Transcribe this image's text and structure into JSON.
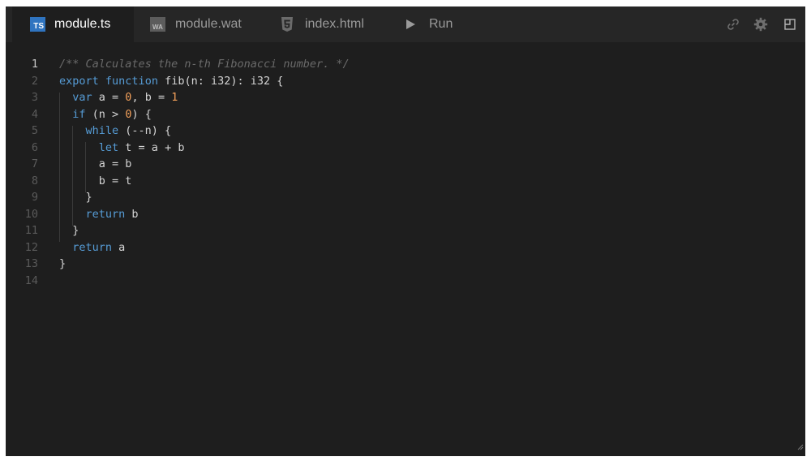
{
  "tabs": [
    {
      "label": "module.ts",
      "icon": "typescript-icon",
      "badge": "TS",
      "active": true
    },
    {
      "label": "module.wat",
      "icon": "wasm-icon",
      "badge": "WA",
      "active": false
    },
    {
      "label": "index.html",
      "icon": "html5-icon",
      "active": false
    },
    {
      "label": "Run",
      "icon": "play-icon",
      "active": false
    }
  ],
  "toolbar_icons": [
    "link-icon",
    "gear-icon",
    "split-view-icon"
  ],
  "colors": {
    "keyword": "#569cd6",
    "number": "#f3a05a",
    "comment": "#6a6a6a",
    "text": "#d4d4d4",
    "background": "#1e1e1e",
    "tab_bar": "#262626",
    "ts_badge": "#2f74c0"
  },
  "editor": {
    "current_line": 1,
    "lines": [
      {
        "n": "1",
        "tokens": [
          {
            "t": "cmt",
            "v": "/** Calculates the n-th Fibonacci number. */"
          }
        ]
      },
      {
        "n": "2",
        "tokens": [
          {
            "t": "kw",
            "v": "export"
          },
          {
            "t": "p",
            "v": " "
          },
          {
            "t": "kw",
            "v": "function"
          },
          {
            "t": "p",
            "v": " fib(n: i32): i32 {"
          }
        ]
      },
      {
        "n": "3",
        "tokens": [
          {
            "t": "p",
            "v": "  "
          },
          {
            "t": "kw",
            "v": "var"
          },
          {
            "t": "p",
            "v": " a = "
          },
          {
            "t": "num",
            "v": "0"
          },
          {
            "t": "p",
            "v": ", b = "
          },
          {
            "t": "num",
            "v": "1"
          }
        ]
      },
      {
        "n": "4",
        "tokens": [
          {
            "t": "p",
            "v": "  "
          },
          {
            "t": "kw",
            "v": "if"
          },
          {
            "t": "p",
            "v": " (n > "
          },
          {
            "t": "num",
            "v": "0"
          },
          {
            "t": "p",
            "v": ") {"
          }
        ]
      },
      {
        "n": "5",
        "tokens": [
          {
            "t": "p",
            "v": "    "
          },
          {
            "t": "kw",
            "v": "while"
          },
          {
            "t": "p",
            "v": " (--n) {"
          }
        ]
      },
      {
        "n": "6",
        "tokens": [
          {
            "t": "p",
            "v": "      "
          },
          {
            "t": "kw",
            "v": "let"
          },
          {
            "t": "p",
            "v": " t = a + b"
          }
        ]
      },
      {
        "n": "7",
        "tokens": [
          {
            "t": "p",
            "v": "      a = b"
          }
        ]
      },
      {
        "n": "8",
        "tokens": [
          {
            "t": "p",
            "v": "      b = t"
          }
        ]
      },
      {
        "n": "9",
        "tokens": [
          {
            "t": "p",
            "v": "    }"
          }
        ]
      },
      {
        "n": "10",
        "tokens": [
          {
            "t": "p",
            "v": "    "
          },
          {
            "t": "kw",
            "v": "return"
          },
          {
            "t": "p",
            "v": " b"
          }
        ]
      },
      {
        "n": "11",
        "tokens": [
          {
            "t": "p",
            "v": "  }"
          }
        ]
      },
      {
        "n": "12",
        "tokens": [
          {
            "t": "p",
            "v": "  "
          },
          {
            "t": "kw",
            "v": "return"
          },
          {
            "t": "p",
            "v": " a"
          }
        ]
      },
      {
        "n": "13",
        "tokens": [
          {
            "t": "p",
            "v": "}"
          }
        ]
      },
      {
        "n": "14",
        "tokens": []
      }
    ]
  }
}
